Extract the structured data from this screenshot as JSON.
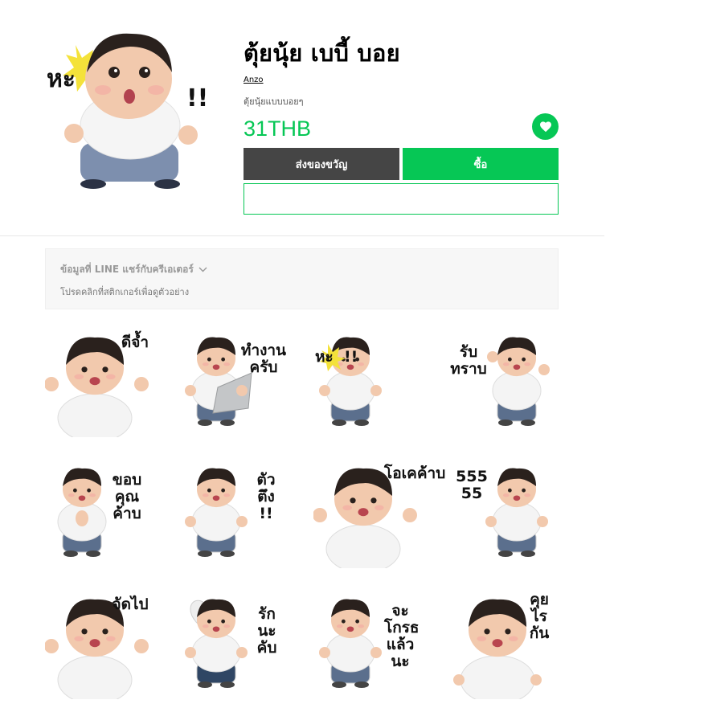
{
  "product": {
    "title": "ตุ้ยนุ้ย เบบี้ บอย",
    "author": "Anzo",
    "description": "ตุ้ยนุ้ยแบบบอยๆ",
    "price": "31THB",
    "gift_label": "ส่งของขวัญ",
    "buy_label": "ซื้อ",
    "hero_caption_left": "หะ",
    "hero_caption_right": "!!",
    "favorite_icon": "heart-icon"
  },
  "info_box": {
    "heading": "ข้อมูลที่ LINE แชร์กับครีเอเตอร์",
    "subtext": "โปรดคลิกที่สติกเกอร์เพื่อดูตัวอย่าง"
  },
  "stickers": [
    {
      "caption": "ดีจ้ำ",
      "shirt": "#f4f4f4",
      "pants": "#ffffff",
      "pose": "arms-up"
    },
    {
      "caption": "ทำงาน\nครับ",
      "shirt": "#f4f4f4",
      "pants": "#5b6f8d",
      "pose": "laptop"
    },
    {
      "caption": "หะ  !!",
      "shirt": "#f4f4f4",
      "pants": "#5b6f8d",
      "pose": "shock"
    },
    {
      "caption": "รับ\nทราบ",
      "shirt": "#f4f4f4",
      "pants": "#5b6f8d",
      "pose": "salute"
    },
    {
      "caption": "ขอบ\nคุณ\nค้าบ",
      "shirt": "#f4f4f4",
      "pants": "#5b6f8d",
      "pose": "pray"
    },
    {
      "caption": "ตัว\nตึง\n!!",
      "shirt": "#f4f4f4",
      "pants": "#5b6f8d",
      "pose": "stand"
    },
    {
      "caption": "โอเคค้าบ",
      "shirt": "#f4f4f4",
      "pants": "#ffffff",
      "pose": "arms-up"
    },
    {
      "caption": "555\n55",
      "shirt": "#f4f4f4",
      "pants": "#5b6f8d",
      "pose": "laugh"
    },
    {
      "caption": "จัดไป",
      "shirt": "#f4f4f4",
      "pants": "#ffffff",
      "pose": "thumbs"
    },
    {
      "caption": "รัก\nนะ\nคับ",
      "shirt": "#f4f4f4",
      "pants": "#2f4664",
      "pose": "balloon"
    },
    {
      "caption": "จะ\nโกรธ\nแล้ว\nนะ",
      "shirt": "#f4f4f4",
      "pants": "#5b6f8d",
      "pose": "stand"
    },
    {
      "caption": "คุย\nไร\nกัน",
      "shirt": "#f4f4f4",
      "pants": "#ffffff",
      "pose": "pout"
    }
  ],
  "colors": {
    "accent": "#06c755",
    "dark_button": "#454545",
    "skin": "#f2c9ad",
    "hair": "#2a211d"
  }
}
